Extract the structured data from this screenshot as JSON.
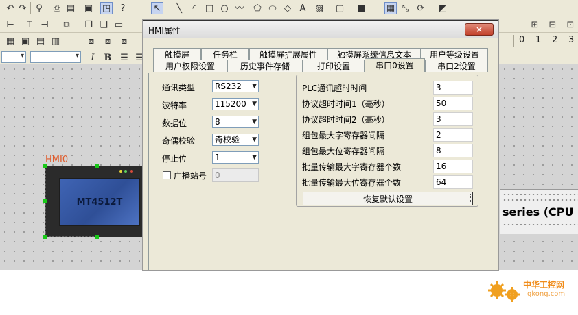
{
  "toolbar": {
    "row3_numbers": [
      "0",
      "1",
      "2",
      "3"
    ]
  },
  "canvas": {
    "hmi_name": "HMI0",
    "hmi_model": "MT4512T",
    "plc_label": "series (CPU P"
  },
  "dialog": {
    "title": "HMI属性",
    "close_label": "×",
    "tabs_row1": [
      "触摸屏",
      "任务栏",
      "触摸屏扩展属性",
      "触摸屏系统信息文本",
      "用户等级设置"
    ],
    "tabs_row2": [
      "用户权限设置",
      "历史事件存储",
      "打印设置",
      "串口0设置",
      "串口2设置"
    ],
    "active_tab": "串口0设置",
    "fields": {
      "comm_type": {
        "label": "通讯类型",
        "value": "RS232"
      },
      "baud_rate": {
        "label": "波特率",
        "value": "115200"
      },
      "data_bits": {
        "label": "数据位",
        "value": "8"
      },
      "parity": {
        "label": "奇偶校验",
        "value": "奇校验"
      },
      "stop_bits": {
        "label": "停止位",
        "value": "1"
      },
      "broadcast": {
        "label": "广播站号",
        "value": "0",
        "checked": false
      }
    },
    "timeouts": [
      {
        "label": "PLC通讯超时时间",
        "value": "3"
      },
      {
        "label": "协议超时时间1（毫秒）",
        "value": "50"
      },
      {
        "label": "协议超时时间2（毫秒）",
        "value": "3"
      },
      {
        "label": "组包最大字寄存器间隔",
        "value": "2"
      },
      {
        "label": "组包最大位寄存器间隔",
        "value": "8"
      },
      {
        "label": "批量传输最大字寄存器个数",
        "value": "16"
      },
      {
        "label": "批量传输最大位寄存器个数",
        "value": "64"
      }
    ],
    "restore_label": "恢复默认设置"
  },
  "watermark": {
    "title": "中华工控网",
    "url": "gkong.com"
  },
  "colors": {
    "hmi_label": "#e05a2a",
    "selection_handle": "#19c919",
    "close_button": "#c2412c",
    "watermark": "#f08c1a"
  }
}
